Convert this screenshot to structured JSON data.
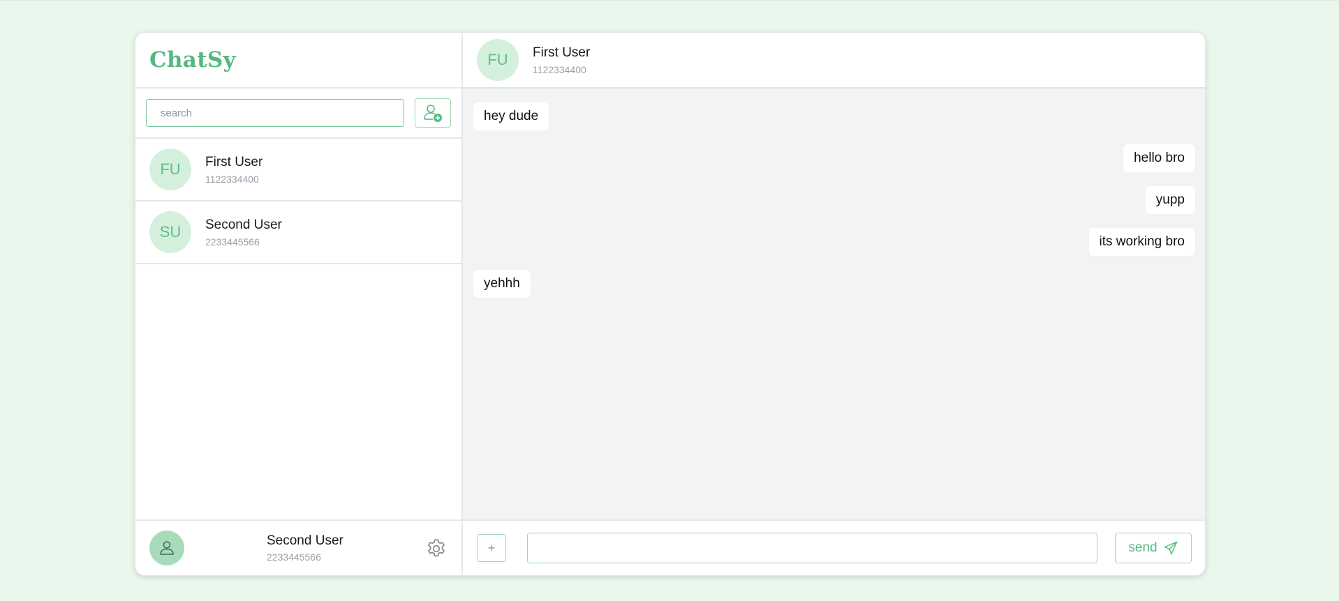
{
  "app": {
    "brand": "ChatSy"
  },
  "search": {
    "placeholder": "search",
    "value": ""
  },
  "contacts": [
    {
      "initials": "FU",
      "name": "First User",
      "phone": "1122334400"
    },
    {
      "initials": "SU",
      "name": "Second User",
      "phone": "2233445566"
    }
  ],
  "chat": {
    "header": {
      "initials": "FU",
      "name": "First User",
      "phone": "1122334400"
    },
    "messages": [
      {
        "text": "hey dude",
        "direction": "in"
      },
      {
        "text": "hello bro",
        "direction": "out"
      },
      {
        "text": "yupp",
        "direction": "out"
      },
      {
        "text": "its working bro",
        "direction": "out"
      },
      {
        "text": "yehhh",
        "direction": "in"
      }
    ]
  },
  "composer": {
    "attach_label": "+",
    "input_value": "",
    "send_label": "send"
  },
  "current_user": {
    "name": "Second User",
    "phone": "2233445566"
  },
  "icons": {
    "add_user": "user-plus-icon",
    "settings": "gear-icon",
    "profile": "user-icon",
    "send": "paper-plane-icon"
  },
  "colors": {
    "accent": "#54b980",
    "avatar_bg": "#d4f0dd",
    "page_bg": "#eaf7ec",
    "messages_bg": "#f2f3f5"
  }
}
